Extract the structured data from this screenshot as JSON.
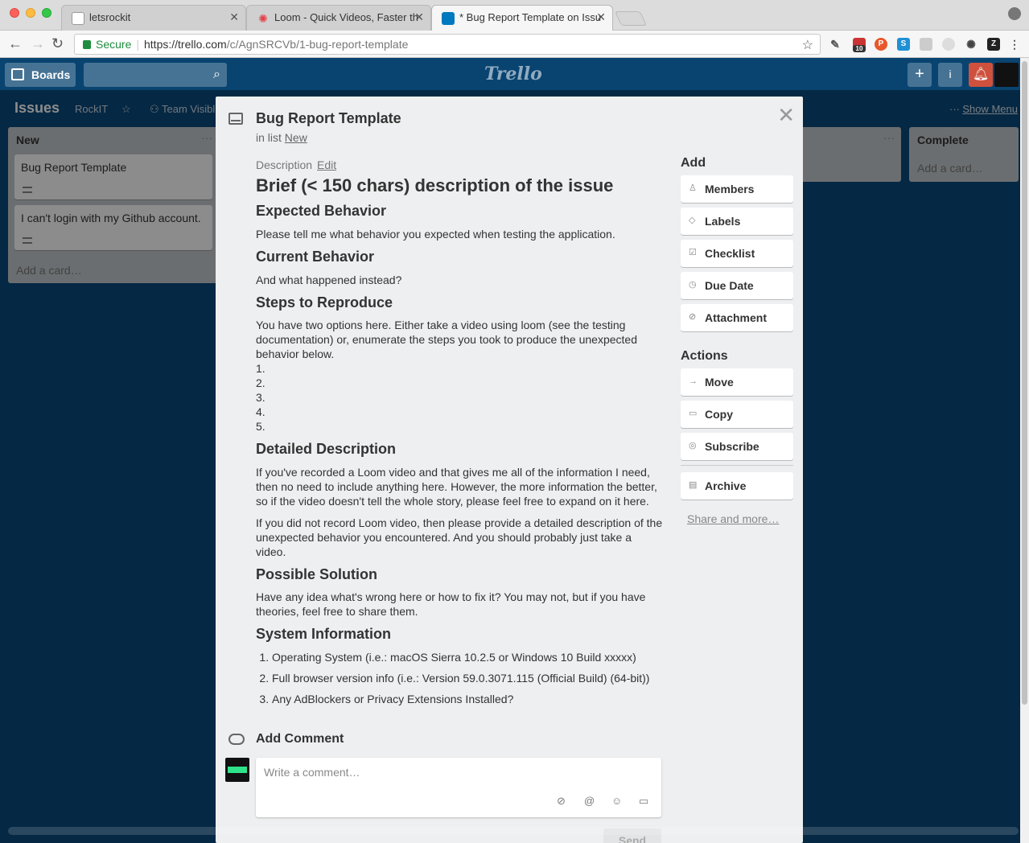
{
  "browser": {
    "tabs": [
      {
        "title": "letsrockit"
      },
      {
        "title": "Loom - Quick Videos, Faster th"
      },
      {
        "title": "* Bug Report Template on Issu"
      }
    ],
    "secure_label": "Secure",
    "url_host": "https://trello.com",
    "url_path": "/c/AgnSRCVb/1-bug-report-template",
    "extension_badge": "10"
  },
  "header": {
    "boards_label": "Boards",
    "logo_text": "Trello",
    "add_icon": "+",
    "info_icon": "i"
  },
  "board": {
    "title": "Issues",
    "team": "RockIT",
    "visibility": "Team Visibl",
    "show_menu": "Show Menu",
    "lists": [
      {
        "name": "New",
        "cards": [
          "Bug Report Template",
          "I can't login with my Github account."
        ],
        "add_card": "Add a card…"
      },
      {
        "name": "Complete",
        "add_card": "Add a card…"
      }
    ]
  },
  "card": {
    "title": "Bug Report Template",
    "in_list_prefix": "in list",
    "in_list_name": "New",
    "description_label": "Description",
    "edit_label": "Edit",
    "description": {
      "heading": "Brief (< 150 chars) description of the issue",
      "expected_h": "Expected Behavior",
      "expected_p": "Please tell me what behavior you expected when testing the application.",
      "current_h": "Current Behavior",
      "current_p": "And what happened instead?",
      "steps_h": "Steps to Reproduce",
      "steps_p": "You have two options here. Either take a video using loom (see the testing documentation) or, enumerate the steps you took to produce the unexpected behavior below.",
      "steps_list": [
        "1.",
        "2.",
        "3.",
        "4.",
        "5."
      ],
      "detailed_h": "Detailed Description",
      "detailed_p1": "If you've recorded a Loom video and that gives me all of the information I need, then no need to include anything here. However, the more information the better, so if the video doesn't tell the whole story, please feel free to expand on it here.",
      "detailed_p2": "If you did not record Loom video, then please provide a detailed description of the unexpected behavior you encountered. And you should probably just take a video.",
      "solution_h": "Possible Solution",
      "solution_p": "Have any idea what's wrong here or how to fix it? You may not, but if you have theories, feel free to share them.",
      "sysinfo_h": "System Information",
      "sysinfo_list": [
        "Operating System (i.e.: macOS Sierra 10.2.5 or Windows 10 Build xxxxx)",
        "Full browser version info (i.e.: Version 59.0.3071.115 (Official Build) (64-bit))",
        "Any AdBlockers or Privacy Extensions Installed?"
      ]
    },
    "sidebar": {
      "add_heading": "Add",
      "add_buttons": [
        "Members",
        "Labels",
        "Checklist",
        "Due Date",
        "Attachment"
      ],
      "actions_heading": "Actions",
      "action_buttons": [
        "Move",
        "Copy",
        "Subscribe"
      ],
      "archive": "Archive",
      "share_more": "Share and more…"
    },
    "comment": {
      "heading": "Add Comment",
      "placeholder": "Write a comment…",
      "send": "Send"
    }
  }
}
